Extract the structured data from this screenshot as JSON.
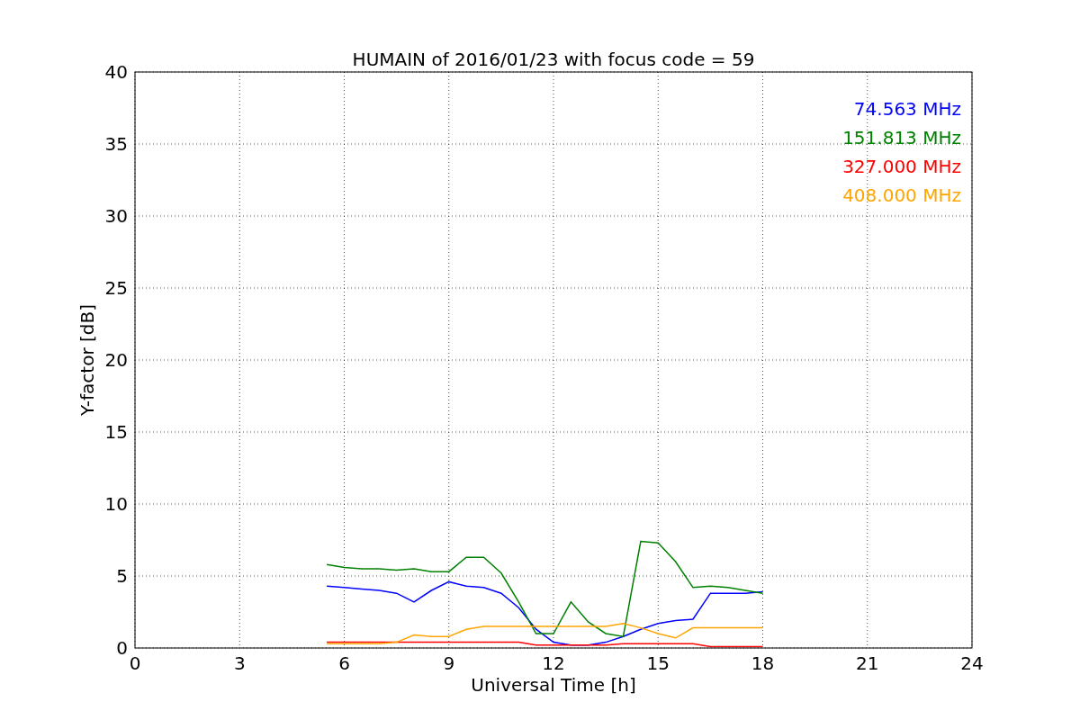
{
  "chart_data": {
    "type": "line",
    "title": "HUMAIN of 2016/01/23 with focus code = 59",
    "xlabel": "Universal Time [h]",
    "ylabel": "Y-factor [dB]",
    "x": [
      5.5,
      6,
      6.5,
      7,
      7.5,
      8,
      8.5,
      9,
      9.5,
      10,
      10.5,
      11,
      11.5,
      12,
      12.5,
      13,
      13.5,
      14,
      14.5,
      15,
      15.5,
      16,
      16.5,
      17,
      17.5,
      18
    ],
    "series": [
      {
        "name": "74.563 MHz",
        "color": "#0000ff",
        "values": [
          4.3,
          4.2,
          4.1,
          4.0,
          3.8,
          3.2,
          4.0,
          4.6,
          4.3,
          4.2,
          3.8,
          2.8,
          1.3,
          0.4,
          0.2,
          0.2,
          0.4,
          0.8,
          1.3,
          1.7,
          1.9,
          2.0,
          3.8,
          3.8,
          3.8,
          3.9
        ]
      },
      {
        "name": "151.813 MHz",
        "color": "#008000",
        "values": [
          5.8,
          5.6,
          5.5,
          5.5,
          5.4,
          5.5,
          5.3,
          5.3,
          6.3,
          6.3,
          5.2,
          3.2,
          1.0,
          1.0,
          3.2,
          1.8,
          1.0,
          0.8,
          7.4,
          7.3,
          6.0,
          4.2,
          4.3,
          4.2,
          4.0,
          3.8
        ]
      },
      {
        "name": "327.000 MHz",
        "color": "#ff0000",
        "values": [
          0.4,
          0.4,
          0.4,
          0.4,
          0.4,
          0.4,
          0.4,
          0.4,
          0.4,
          0.4,
          0.4,
          0.4,
          0.2,
          0.2,
          0.2,
          0.2,
          0.2,
          0.3,
          0.3,
          0.3,
          0.3,
          0.3,
          0.1,
          0.1,
          0.1,
          0.1
        ]
      },
      {
        "name": "408.000 MHz",
        "color": "#ffa500",
        "values": [
          0.3,
          0.3,
          0.3,
          0.3,
          0.4,
          0.9,
          0.8,
          0.8,
          1.3,
          1.5,
          1.5,
          1.5,
          1.5,
          1.5,
          1.5,
          1.5,
          1.5,
          1.7,
          1.4,
          1.0,
          0.7,
          1.4,
          1.4,
          1.4,
          1.4,
          1.4
        ]
      }
    ],
    "xlim": [
      0,
      24
    ],
    "ylim": [
      0,
      40
    ],
    "xticks": [
      0,
      3,
      6,
      9,
      12,
      15,
      18,
      21,
      24
    ],
    "yticks": [
      0,
      5,
      10,
      15,
      20,
      25,
      30,
      35,
      40
    ],
    "grid": true
  }
}
